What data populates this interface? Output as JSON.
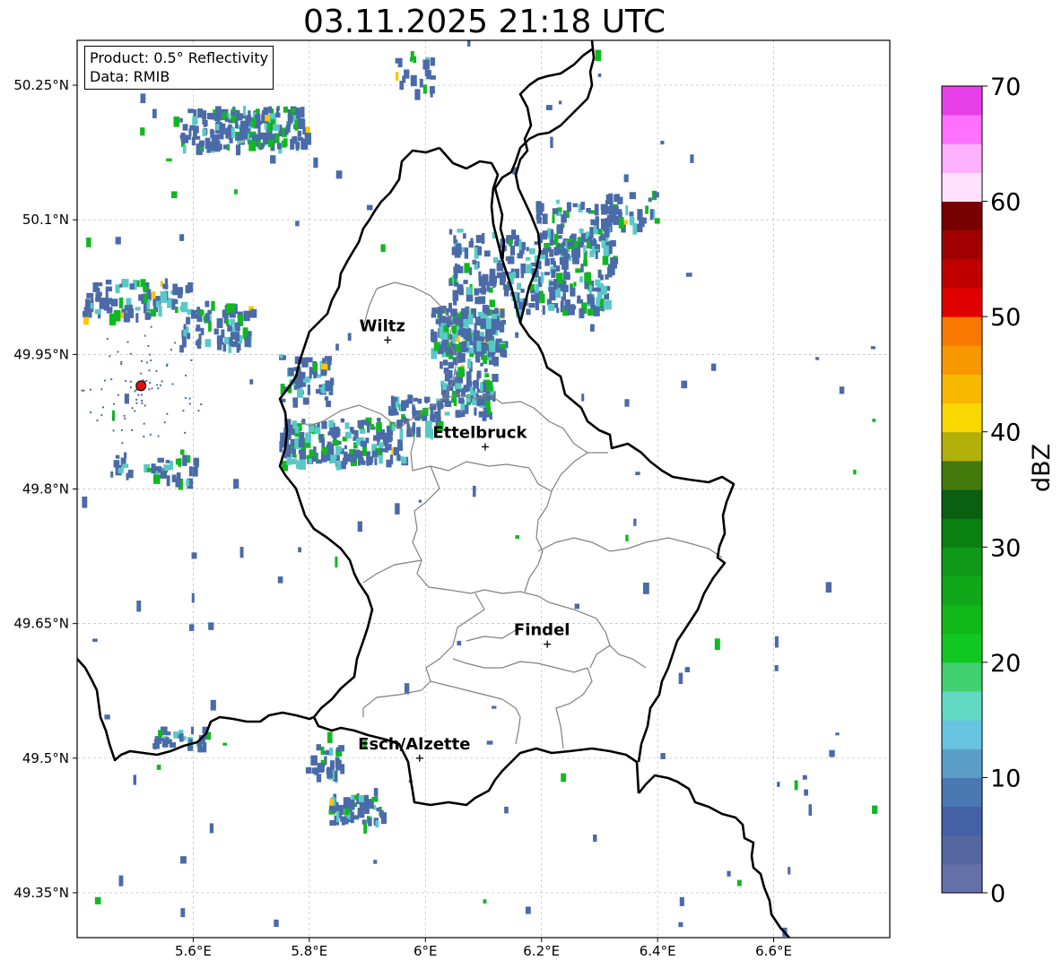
{
  "title": "03.11.2025 21:18 UTC",
  "info": {
    "product": "Product: 0.5° Reflectivity",
    "source": "Data: RMIB"
  },
  "map": {
    "lon_range": [
      5.4,
      6.8
    ],
    "lat_range": [
      49.3,
      50.3
    ],
    "x_ticks": [
      "5.6°E",
      "5.8°E",
      "6°E",
      "6.2°E",
      "6.4°E",
      "6.6°E"
    ],
    "y_ticks": [
      "50.25°N",
      "50.1°N",
      "49.95°N",
      "49.8°N",
      "49.65°N",
      "49.5°N",
      "49.35°N"
    ],
    "grid": true,
    "radar_site": {
      "name": "radar-site",
      "lon": 5.51,
      "lat": 49.915,
      "color": "#e01010"
    },
    "cities": [
      {
        "label": "Wiltz",
        "lon": 5.935,
        "lat": 49.966
      },
      {
        "label": "Ettelbruck",
        "lon": 6.103,
        "lat": 49.847
      },
      {
        "label": "Findel",
        "lon": 6.21,
        "lat": 49.627
      },
      {
        "label": "Esch/Alzette",
        "lon": 5.99,
        "lat": 49.5
      }
    ]
  },
  "colorbar": {
    "label": "dBZ",
    "min": 0,
    "max": 70,
    "ticks": [
      "0",
      "10",
      "20",
      "30",
      "40",
      "50",
      "60",
      "70"
    ],
    "colors": [
      "#6470a8",
      "#5566a0",
      "#4460a6",
      "#4a78b0",
      "#5a9ec8",
      "#66c4e0",
      "#60d8c4",
      "#40d070",
      "#10c820",
      "#10b818",
      "#10a818",
      "#109818",
      "#0a8010",
      "#086010",
      "#447a0c",
      "#b0b008",
      "#f8d800",
      "#f8b800",
      "#f89800",
      "#f87800",
      "#e00000",
      "#c00000",
      "#a00000",
      "#780000",
      "#ffe0ff",
      "#ffb0ff",
      "#ff70ff",
      "#e840e8"
    ]
  },
  "colors": {
    "border": "#000000",
    "district": "#808080",
    "grid": "#bbbbbb",
    "rain_light": "#4a6aa8",
    "rain_medium": "#5ac8c8",
    "rain_heavy": "#10b820",
    "rain_intense": "#f8c800"
  }
}
